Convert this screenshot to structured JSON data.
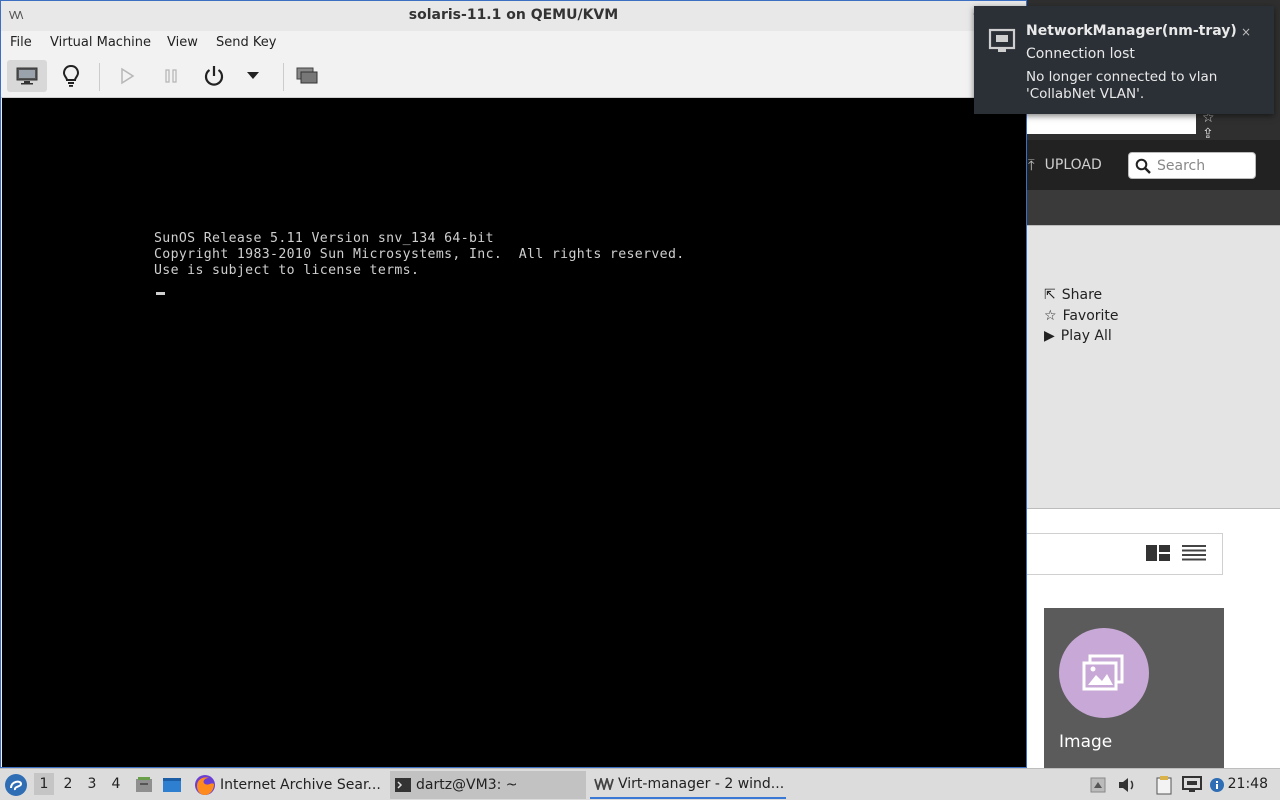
{
  "vm_window": {
    "title": "solaris-11.1 on QEMU/KVM",
    "app_icon_text": "\\/\\/\\",
    "minimize_glyph": "–",
    "menu": [
      "File",
      "Virtual Machine",
      "View",
      "Send Key"
    ],
    "toolbar": {
      "buttons": [
        "console-view",
        "details-view",
        "run",
        "pause",
        "shutdown",
        "shutdown-menu",
        "fullscreen"
      ]
    },
    "console_lines": [
      "SunOS Release 5.11 Version snv_134 64-bit",
      "Copyright 1983-2010 Sun Microsystems, Inc.  All rights reserved.",
      "Use is subject to license terms."
    ]
  },
  "notification": {
    "title": "NetworkManager(nm-tray)",
    "summary": "Connection lost",
    "body": "No longer connected to vlan 'CollabNet VLAN'.",
    "close": "×"
  },
  "browser": {
    "upload_label": "UPLOAD",
    "search_placeholder": "Search",
    "actions": [
      "Share",
      "Favorite",
      "Play All"
    ],
    "media_label": "Image"
  },
  "taskbar": {
    "workspaces": [
      "1",
      "2",
      "3",
      "4"
    ],
    "active_workspace": "1",
    "tasks": [
      "Internet Archive Sear...",
      "dartz@VM3: ~",
      "Virt-manager - 2 wind..."
    ],
    "clock": "21:48"
  },
  "colors": {
    "accent": "#3b77d4",
    "notification_bg": "#2b3036",
    "console_bg": "#000000",
    "media_circle": "#c8a8d6"
  }
}
